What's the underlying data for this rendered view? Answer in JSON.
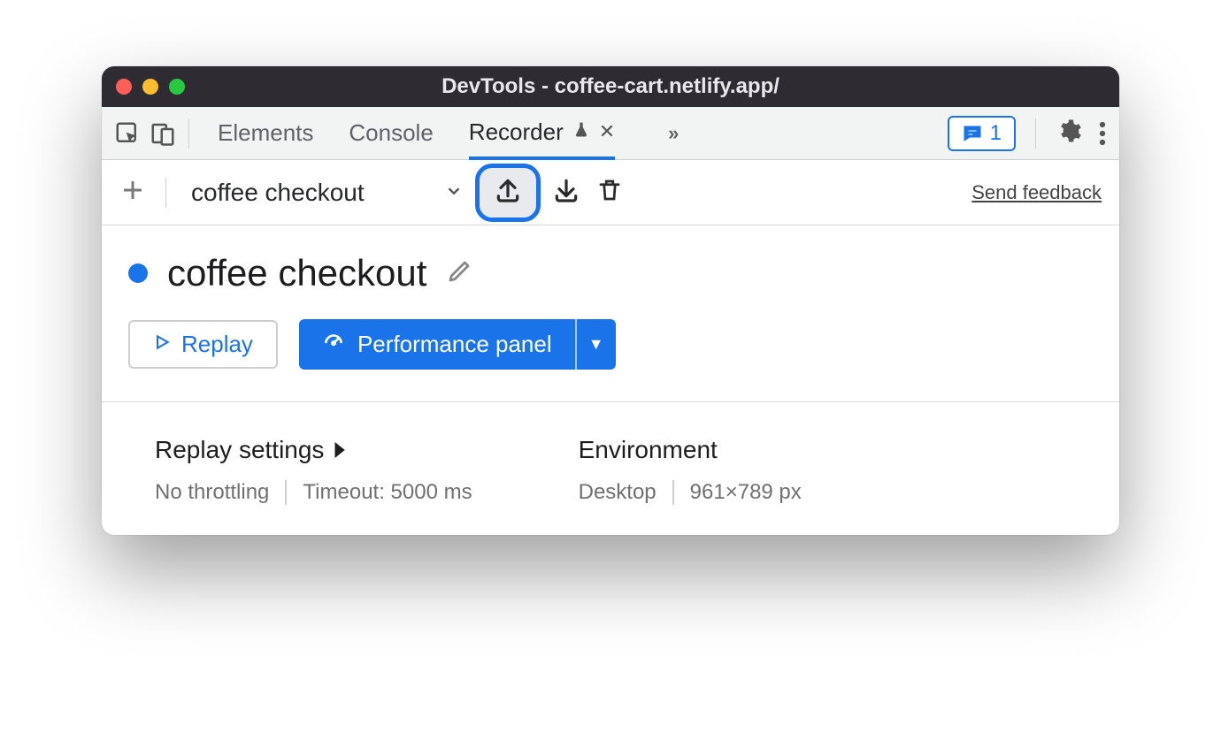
{
  "window": {
    "title": "DevTools - coffee-cart.netlify.app/"
  },
  "tabs": {
    "items": [
      "Elements",
      "Console",
      "Recorder"
    ],
    "active": "Recorder"
  },
  "messages_badge": "1",
  "recorder": {
    "recording_name": "coffee checkout",
    "feedback_link": "Send feedback",
    "title": "coffee checkout",
    "buttons": {
      "replay": "Replay",
      "performance": "Performance panel"
    },
    "settings": {
      "replay_heading": "Replay settings",
      "throttling": "No throttling",
      "timeout": "Timeout: 5000 ms",
      "env_heading": "Environment",
      "device": "Desktop",
      "dimensions": "961×789 px"
    }
  }
}
